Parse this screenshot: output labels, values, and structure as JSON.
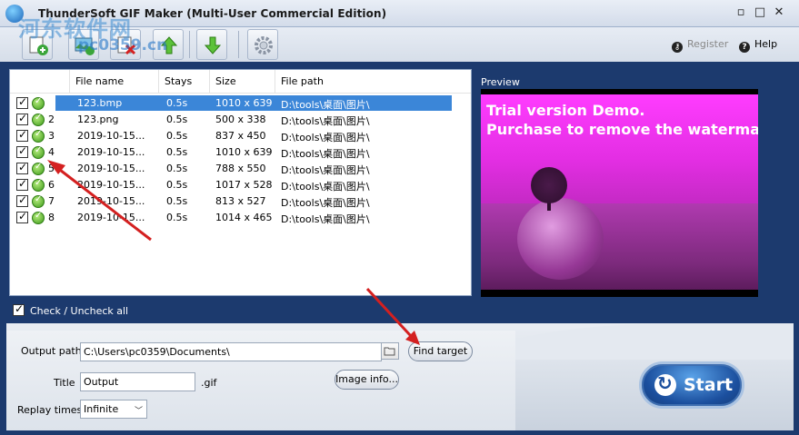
{
  "window": {
    "title": "ThunderSoft GIF Maker (Multi-User Commercial Edition)",
    "minimize": "▫",
    "maximize": "□",
    "close": "✕"
  },
  "watermark": {
    "text1": "河东软件网",
    "text2": "pc0359.cn"
  },
  "toolbar": {
    "register_label": "Register",
    "help_label": "Help"
  },
  "file_list": {
    "columns": [
      "",
      "File name",
      "Stays",
      "Size",
      "File path"
    ],
    "rows": [
      {
        "index": "1",
        "name": "123.bmp",
        "stays": "0.5s",
        "size": "1010 x 639",
        "path": "D:\\tools\\桌面\\图片\\"
      },
      {
        "index": "2",
        "name": "123.png",
        "stays": "0.5s",
        "size": "500 x 338",
        "path": "D:\\tools\\桌面\\图片\\"
      },
      {
        "index": "3",
        "name": "2019-10-15...",
        "stays": "0.5s",
        "size": "837 x 450",
        "path": "D:\\tools\\桌面\\图片\\"
      },
      {
        "index": "4",
        "name": "2019-10-15...",
        "stays": "0.5s",
        "size": "1010 x 639",
        "path": "D:\\tools\\桌面\\图片\\"
      },
      {
        "index": "5",
        "name": "2019-10-15...",
        "stays": "0.5s",
        "size": "788 x 550",
        "path": "D:\\tools\\桌面\\图片\\"
      },
      {
        "index": "6",
        "name": "2019-10-15...",
        "stays": "0.5s",
        "size": "1017 x 528",
        "path": "D:\\tools\\桌面\\图片\\"
      },
      {
        "index": "7",
        "name": "2019-10-15...",
        "stays": "0.5s",
        "size": "813 x 527",
        "path": "D:\\tools\\桌面\\图片\\"
      },
      {
        "index": "8",
        "name": "2019-10-15...",
        "stays": "0.5s",
        "size": "1014 x 465",
        "path": "D:\\tools\\桌面\\图片\\"
      }
    ],
    "selected_index": 0
  },
  "check_all_label": "Check / Uncheck all",
  "preview": {
    "label": "Preview",
    "watermark_line1": "Trial version Demo.",
    "watermark_line2": "Purchase to remove the watermark"
  },
  "options": {
    "output_path_label": "Output path",
    "output_path_value": "C:\\Users\\pc0359\\Documents\\",
    "find_target_label": "Find target",
    "title_label": "Title",
    "title_value": "Output",
    "title_ext": ".gif",
    "image_info_label": "Image info...",
    "replay_label": "Replay times",
    "replay_value": "Infinite"
  },
  "start_label": "Start",
  "colors": {
    "panel_blue": "#1c3a6e",
    "selection_blue": "#3b86d8",
    "arrow_red": "#d42020",
    "preview_magenta": "#e32ee3"
  }
}
